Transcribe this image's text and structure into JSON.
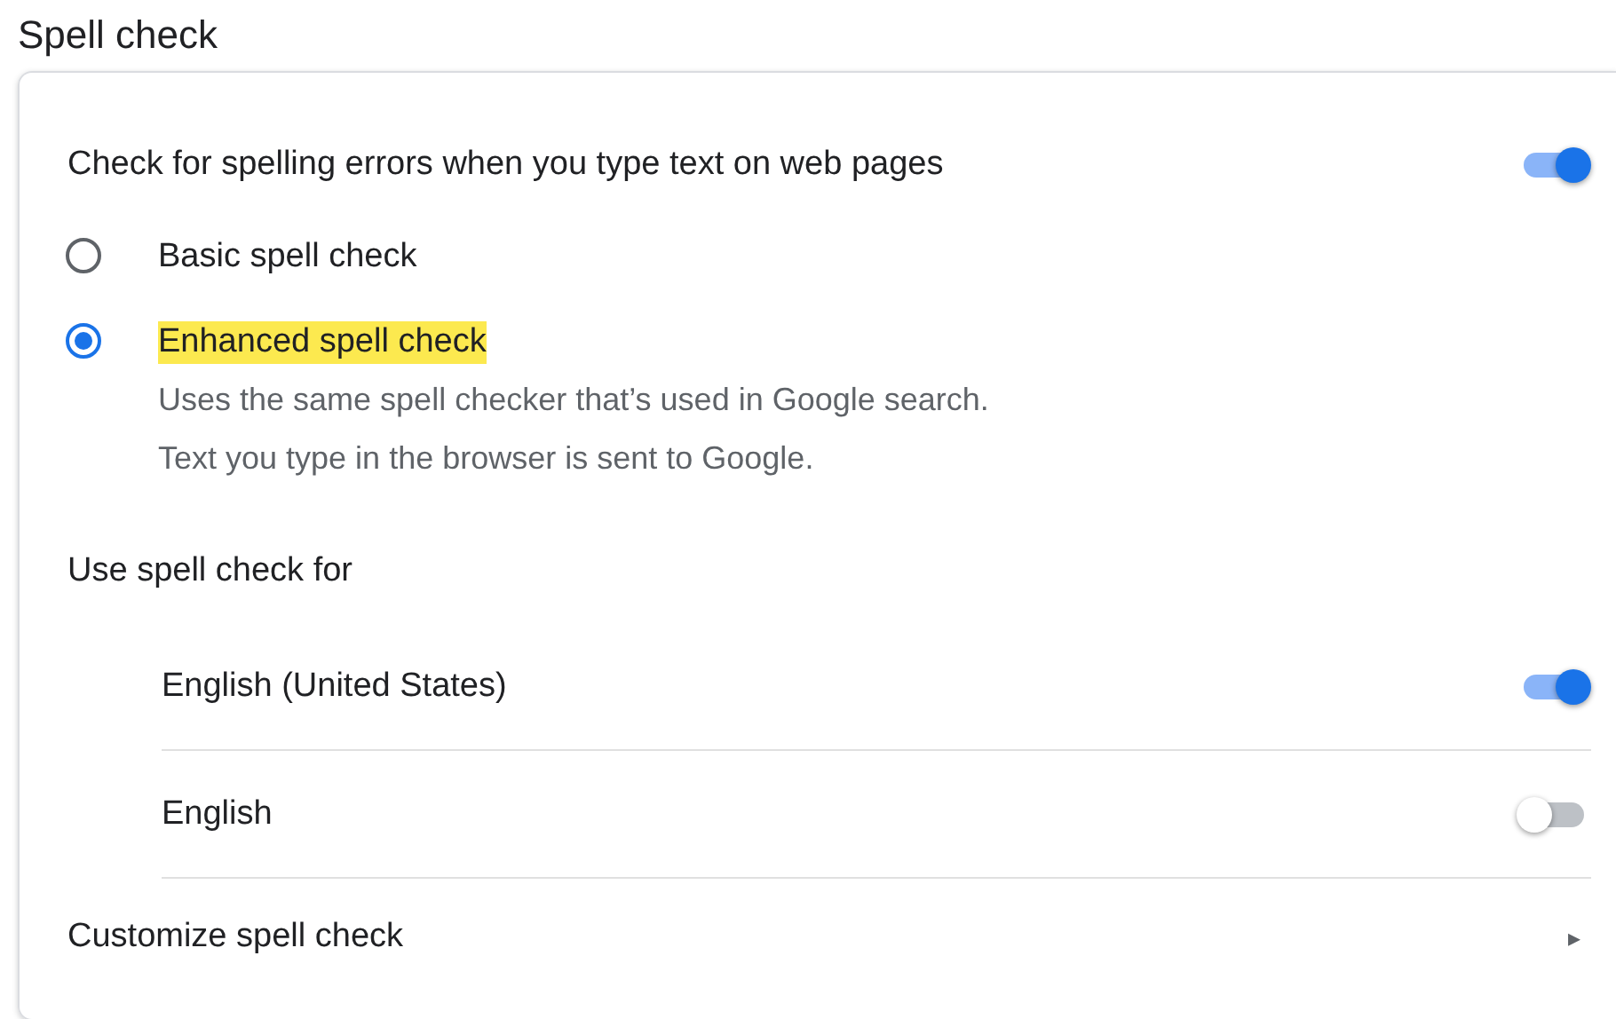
{
  "section_title": "Spell check",
  "main_toggle": {
    "label": "Check for spelling errors when you type text on web pages",
    "on": true
  },
  "modes": [
    {
      "label": "Basic spell check",
      "selected": false,
      "highlighted": false
    },
    {
      "label": "Enhanced spell check",
      "selected": true,
      "highlighted": true,
      "description": [
        "Uses the same spell checker that’s used in Google search.",
        "Text you type in the browser is sent to Google."
      ]
    }
  ],
  "languages_heading": "Use spell check for",
  "languages": [
    {
      "label": "English (United States)",
      "on": true
    },
    {
      "label": "English",
      "on": false
    }
  ],
  "customize": {
    "label": "Customize spell check",
    "arrow": "▸"
  }
}
